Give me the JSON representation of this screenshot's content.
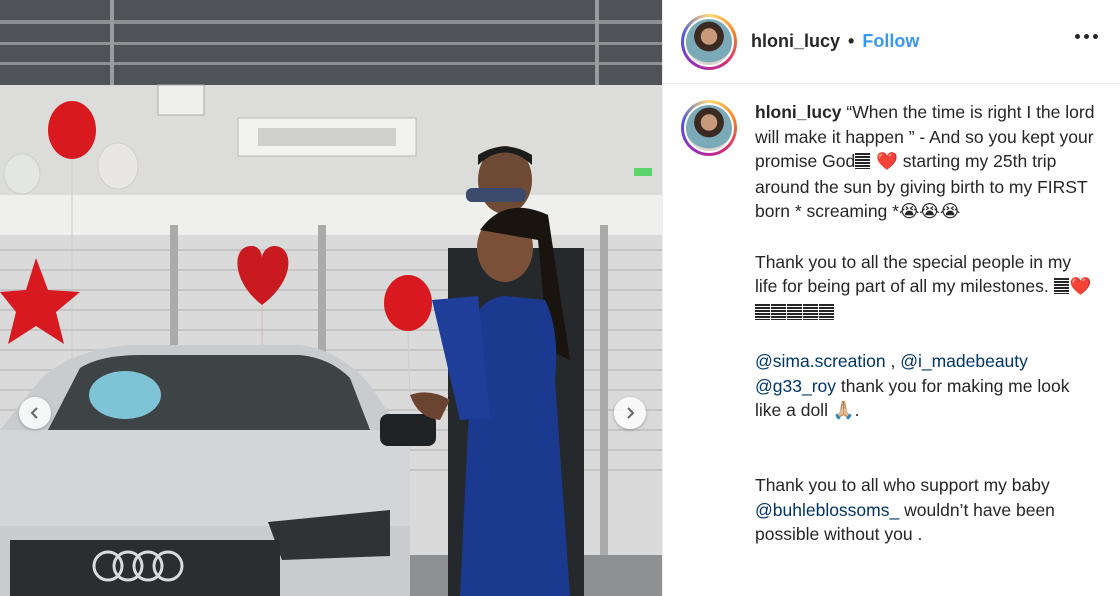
{
  "post": {
    "username": "hloni_lucy",
    "separator": "•",
    "follow_label": "Follow",
    "more_icon": "more-options-icon"
  },
  "caption": {
    "username": "hloni_lucy",
    "line1": "“When the time is right I the lord will make it happen ” -",
    "line2a": "And so you kept your promise God",
    "line2b": "starting my 25th trip around the sun by giving birth to my FIRST born * screaming *",
    "emoji_cry": "😭😭😭",
    "emoji_heart": "❤️",
    "para2": "Thank you to all the special people in my life for being part of all my milestones.",
    "mention1": "@sima.screation",
    "sep1": " , ",
    "mention2": "@i_madebeauty",
    "mention3": "@g33_roy",
    "para3_rest": " thank you for making me look like a doll ",
    "emoji_pray": "🙏🏼",
    "para3_end": ".",
    "para4a": "Thank you to all who support my baby ",
    "mention4": "@buhleblossoms_",
    "para4b": " wouldn’t have been possible without you ."
  },
  "colors": {
    "follow": "#3897f0",
    "mention": "#003569",
    "text": "#262626",
    "balloon_red": "#d8191f",
    "dress_blue": "#1b3a8f",
    "car_silver": "#c9ccce"
  },
  "carousel": {
    "prev_icon": "chevron-left-icon",
    "next_icon": "chevron-right-icon"
  }
}
